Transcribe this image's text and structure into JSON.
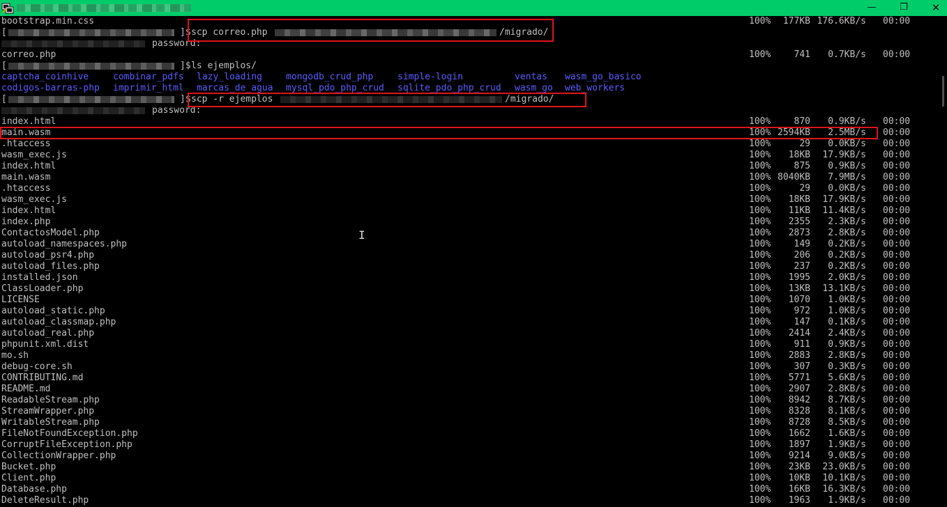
{
  "titlebar": {
    "title_redacted": "",
    "controls": {
      "minimize": "—",
      "maximize": "❐",
      "close": "✕"
    }
  },
  "colors": {
    "titlebar": "#00cc6a",
    "background": "#000000",
    "text": "#c0c0c0",
    "directory": "#5c5cff",
    "highlight": "#e0141a"
  },
  "terminal": {
    "top_file": {
      "name": "bootstrap.min.css",
      "pct": "100%",
      "size": "177KB",
      "rate": "176.6KB/s",
      "time": "00:00"
    },
    "prompt_suffix": "]$",
    "prompt_bracket": "[",
    "password_label": "password:",
    "cmd_scp_correo": {
      "prefix": "scp correo.php ",
      "suffix": "/migrado/"
    },
    "correo_file": {
      "name": "correo.php",
      "pct": "100%",
      "size": "741",
      "rate": "0.7KB/s",
      "time": "00:00"
    },
    "cmd_ls": "ls ejemplos/",
    "ls_dirs_row1": [
      "captcha_coinhive",
      "combinar_pdfs",
      "lazy_loading",
      "mongodb_crud_php",
      "simple-login",
      "ventas",
      "wasm_go_basico"
    ],
    "ls_dirs_row2": [
      "codigos-barras-php",
      "imprimir_html",
      "marcas_de_agua",
      "mysql_pdo_php_crud",
      "sqlite_pdo_php_crud",
      "wasm_go",
      "web_workers"
    ],
    "cmd_scp_ejemplos": {
      "prefix": "scp -r ejemplos ",
      "suffix": "/migrado/"
    },
    "files": [
      {
        "name": "index.html",
        "pct": "100%",
        "size": "870",
        "rate": "0.9KB/s",
        "time": "00:00"
      },
      {
        "name": "main.wasm",
        "pct": "100%",
        "size": "2594KB",
        "rate": "2.5MB/s",
        "time": "00:00"
      },
      {
        "name": ".htaccess",
        "pct": "100%",
        "size": "29",
        "rate": "0.0KB/s",
        "time": "00:00"
      },
      {
        "name": "wasm_exec.js",
        "pct": "100%",
        "size": "18KB",
        "rate": "17.9KB/s",
        "time": "00:00"
      },
      {
        "name": "index.html",
        "pct": "100%",
        "size": "875",
        "rate": "0.9KB/s",
        "time": "00:00"
      },
      {
        "name": "main.wasm",
        "pct": "100%",
        "size": "8040KB",
        "rate": "7.9MB/s",
        "time": "00:00"
      },
      {
        "name": ".htaccess",
        "pct": "100%",
        "size": "29",
        "rate": "0.0KB/s",
        "time": "00:00"
      },
      {
        "name": "wasm_exec.js",
        "pct": "100%",
        "size": "18KB",
        "rate": "17.9KB/s",
        "time": "00:00"
      },
      {
        "name": "index.html",
        "pct": "100%",
        "size": "11KB",
        "rate": "11.4KB/s",
        "time": "00:00"
      },
      {
        "name": "index.php",
        "pct": "100%",
        "size": "2355",
        "rate": "2.3KB/s",
        "time": "00:00"
      },
      {
        "name": "ContactosModel.php",
        "pct": "100%",
        "size": "2873",
        "rate": "2.8KB/s",
        "time": "00:00"
      },
      {
        "name": "autoload_namespaces.php",
        "pct": "100%",
        "size": "149",
        "rate": "0.2KB/s",
        "time": "00:00"
      },
      {
        "name": "autoload_psr4.php",
        "pct": "100%",
        "size": "206",
        "rate": "0.2KB/s",
        "time": "00:00"
      },
      {
        "name": "autoload_files.php",
        "pct": "100%",
        "size": "237",
        "rate": "0.2KB/s",
        "time": "00:00"
      },
      {
        "name": "installed.json",
        "pct": "100%",
        "size": "1995",
        "rate": "2.0KB/s",
        "time": "00:00"
      },
      {
        "name": "ClassLoader.php",
        "pct": "100%",
        "size": "13KB",
        "rate": "13.1KB/s",
        "time": "00:00"
      },
      {
        "name": "LICENSE",
        "pct": "100%",
        "size": "1070",
        "rate": "1.0KB/s",
        "time": "00:00"
      },
      {
        "name": "autoload_static.php",
        "pct": "100%",
        "size": "972",
        "rate": "1.0KB/s",
        "time": "00:00"
      },
      {
        "name": "autoload_classmap.php",
        "pct": "100%",
        "size": "147",
        "rate": "0.1KB/s",
        "time": "00:00"
      },
      {
        "name": "autoload_real.php",
        "pct": "100%",
        "size": "2414",
        "rate": "2.4KB/s",
        "time": "00:00"
      },
      {
        "name": "phpunit.xml.dist",
        "pct": "100%",
        "size": "911",
        "rate": "0.9KB/s",
        "time": "00:00"
      },
      {
        "name": "mo.sh",
        "pct": "100%",
        "size": "2883",
        "rate": "2.8KB/s",
        "time": "00:00"
      },
      {
        "name": "debug-core.sh",
        "pct": "100%",
        "size": "307",
        "rate": "0.3KB/s",
        "time": "00:00"
      },
      {
        "name": "CONTRIBUTING.md",
        "pct": "100%",
        "size": "5771",
        "rate": "5.6KB/s",
        "time": "00:00"
      },
      {
        "name": "README.md",
        "pct": "100%",
        "size": "2907",
        "rate": "2.8KB/s",
        "time": "00:00"
      },
      {
        "name": "ReadableStream.php",
        "pct": "100%",
        "size": "8942",
        "rate": "8.7KB/s",
        "time": "00:00"
      },
      {
        "name": "StreamWrapper.php",
        "pct": "100%",
        "size": "8328",
        "rate": "8.1KB/s",
        "time": "00:00"
      },
      {
        "name": "WritableStream.php",
        "pct": "100%",
        "size": "8728",
        "rate": "8.5KB/s",
        "time": "00:00"
      },
      {
        "name": "FileNotFoundException.php",
        "pct": "100%",
        "size": "1662",
        "rate": "1.6KB/s",
        "time": "00:00"
      },
      {
        "name": "CorruptFileException.php",
        "pct": "100%",
        "size": "1897",
        "rate": "1.9KB/s",
        "time": "00:00"
      },
      {
        "name": "CollectionWrapper.php",
        "pct": "100%",
        "size": "9214",
        "rate": "9.0KB/s",
        "time": "00:00"
      },
      {
        "name": "Bucket.php",
        "pct": "100%",
        "size": "23KB",
        "rate": "23.0KB/s",
        "time": "00:00"
      },
      {
        "name": "Client.php",
        "pct": "100%",
        "size": "10KB",
        "rate": "10.1KB/s",
        "time": "00:00"
      },
      {
        "name": "Database.php",
        "pct": "100%",
        "size": "16KB",
        "rate": "16.3KB/s",
        "time": "00:00"
      },
      {
        "name": "DeleteResult.php",
        "pct": "100%",
        "size": "1963",
        "rate": "1.9KB/s",
        "time": "00:00"
      }
    ]
  }
}
